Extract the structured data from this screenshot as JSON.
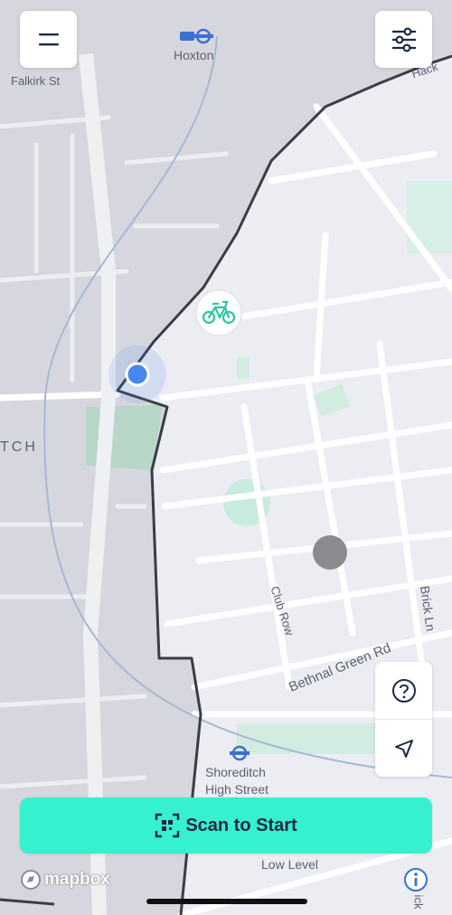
{
  "map": {
    "labels": {
      "hoxton": "Hoxton",
      "falkirk": "Falkirk St",
      "hackney": "Hack",
      "district": "TCH",
      "club_row": "Club Row",
      "bethnal": "Bethnal Green Rd",
      "brick_ln": "Brick Ln",
      "shoreditch_1": "Shoreditch",
      "shoreditch_2": "High Street",
      "low_level": "Low Level",
      "brick_bottom": "ick"
    },
    "attribution": "mapbox"
  },
  "toolbar": {
    "menu_icon": "hamburger-menu-icon",
    "filter_icon": "sliders-filter-icon"
  },
  "controls": {
    "help_icon": "question-icon",
    "locate_icon": "navigation-arrow-icon",
    "info_icon": "info-icon"
  },
  "scan_button": {
    "label": "Scan to Start",
    "icon": "qr-scan-icon"
  },
  "colors": {
    "accent": "#36f1cd",
    "accent_text": "#1e2940",
    "user_location": "#4a86f0",
    "bike_marker": "#2ec4a8",
    "zone_border": "#3a3d44",
    "outside_zone": "#d6d7de",
    "inside_zone": "#ecedf3",
    "park": "#c9ebdf"
  }
}
